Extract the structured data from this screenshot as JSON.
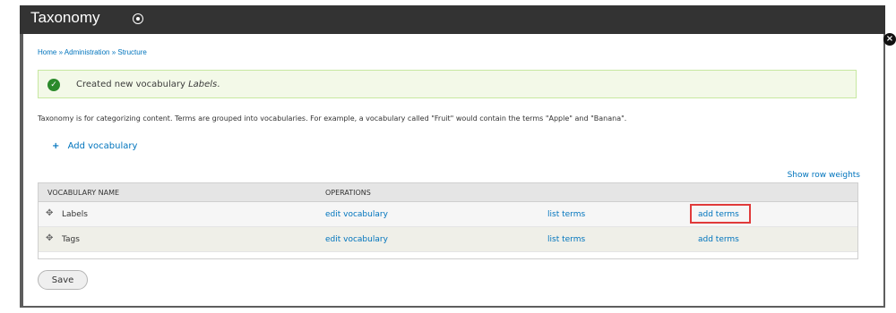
{
  "title": "Taxonomy",
  "breadcrumb": "Home » Administration » Structure",
  "status": {
    "message_prefix": "Created new vocabulary",
    "message_vocab": "Labels"
  },
  "intro": "Taxonomy is for categorizing content. Terms are grouped into vocabularies. For example, a vocabulary called \"Fruit\" would contain the terms \"Apple\" and \"Banana\".",
  "actions": {
    "add_vocabulary": "Add vocabulary",
    "show_row_weights": "Show row weights"
  },
  "table": {
    "headers": [
      "VOCABULARY NAME",
      "OPERATIONS"
    ],
    "rows": [
      {
        "name": "Labels",
        "edit": "edit vocabulary",
        "list": "list terms",
        "add": "add terms"
      },
      {
        "name": "Tags",
        "edit": "edit vocabulary",
        "list": "list terms",
        "add": "add terms"
      }
    ]
  },
  "buttons": {
    "save": "Save"
  },
  "colors": {
    "link": "#0074bd",
    "status_bg": "#f3f9e8",
    "highlight": "#e03a3a"
  }
}
